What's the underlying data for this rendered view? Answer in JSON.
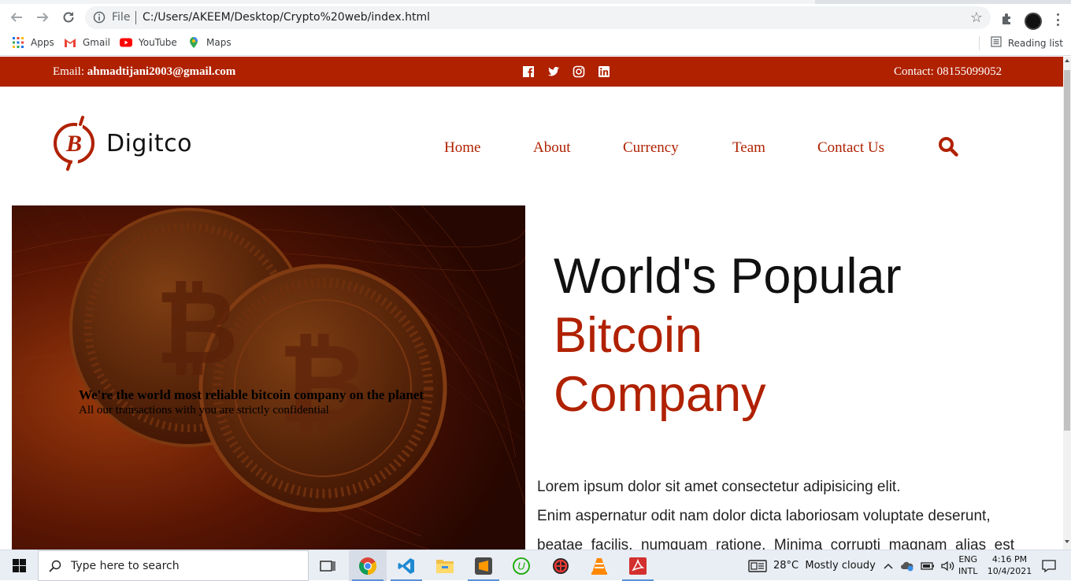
{
  "browser": {
    "file_label": "File",
    "url": "C:/Users/AKEEM/Desktop/Crypto%20web/index.html",
    "bookmarks": [
      {
        "label": "Apps",
        "icon": "apps-grid-icon"
      },
      {
        "label": "Gmail",
        "icon": "gmail-icon"
      },
      {
        "label": "YouTube",
        "icon": "youtube-icon"
      },
      {
        "label": "Maps",
        "icon": "maps-icon"
      }
    ],
    "reading_list": "Reading list"
  },
  "site": {
    "topbar": {
      "email_label": "Email:",
      "email": "ahmadtijani2003@gmail.com",
      "socials": [
        "facebook-icon",
        "twitter-icon",
        "instagram-icon",
        "linkedin-icon"
      ],
      "contact": "Contact: 08155099052"
    },
    "brand": "Digitco",
    "nav": [
      "Home",
      "About",
      "Currency",
      "Team",
      "Contact Us"
    ],
    "hero": {
      "caption_title": "We're the world most reliable bitcoin company on the planet",
      "caption_sub": "All our transactions with you are strictly confidential"
    },
    "headline": {
      "line1": "World's Popular",
      "line2": "Bitcoin",
      "line3": "Company"
    },
    "lorem": {
      "p1": "Lorem ipsum dolor sit amet consectetur adipisicing elit.",
      "p2": "Enim aspernatur odit nam dolor dicta laboriosam voluptate deserunt,",
      "p3": "beatae facilis, numquam ratione. Minima corrupti magnam alias est"
    },
    "accent_color": "#b02100"
  },
  "taskbar": {
    "search_placeholder": "Type here to search",
    "weather": "28°C  Mostly cloudy",
    "lang_top": "ENG",
    "lang_bottom": "INTL",
    "time": "4:16 PM",
    "date": "10/4/2021"
  }
}
